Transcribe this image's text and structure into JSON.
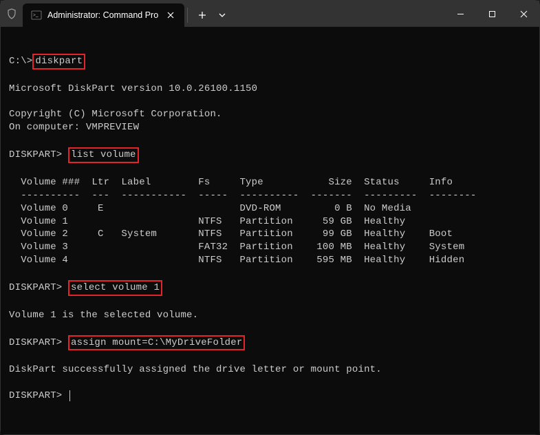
{
  "window": {
    "tab_title": "Administrator: Command Pro"
  },
  "terminal": {
    "prompt_initial": "C:\\>",
    "cmd_diskpart": "diskpart",
    "version_line": "Microsoft DiskPart version 10.0.26100.1150",
    "copyright_line": "Copyright (C) Microsoft Corporation.",
    "computer_line": "On computer: VMPREVIEW",
    "prompt_dp": "DISKPART>",
    "cmd_list_volume": "list volume",
    "table": {
      "headers": {
        "volume": "Volume ###",
        "ltr": "Ltr",
        "label": "Label",
        "fs": "Fs",
        "type": "Type",
        "size": "Size",
        "status": "Status",
        "info": "Info"
      },
      "rows": [
        {
          "vol": "Volume 0",
          "ltr": "E",
          "label": "",
          "fs": "",
          "type": "DVD-ROM",
          "size": "0 B",
          "status": "No Media",
          "info": ""
        },
        {
          "vol": "Volume 1",
          "ltr": "",
          "label": "",
          "fs": "NTFS",
          "type": "Partition",
          "size": "59 GB",
          "status": "Healthy",
          "info": ""
        },
        {
          "vol": "Volume 2",
          "ltr": "C",
          "label": "System",
          "fs": "NTFS",
          "type": "Partition",
          "size": "99 GB",
          "status": "Healthy",
          "info": "Boot"
        },
        {
          "vol": "Volume 3",
          "ltr": "",
          "label": "",
          "fs": "FAT32",
          "type": "Partition",
          "size": "100 MB",
          "status": "Healthy",
          "info": "System"
        },
        {
          "vol": "Volume 4",
          "ltr": "",
          "label": "",
          "fs": "NTFS",
          "type": "Partition",
          "size": "595 MB",
          "status": "Healthy",
          "info": "Hidden"
        }
      ]
    },
    "cmd_select_volume": "select volume 1",
    "select_response": "Volume 1 is the selected volume.",
    "cmd_assign": "assign mount=C:\\MyDriveFolder",
    "assign_response": "DiskPart successfully assigned the drive letter or mount point."
  }
}
